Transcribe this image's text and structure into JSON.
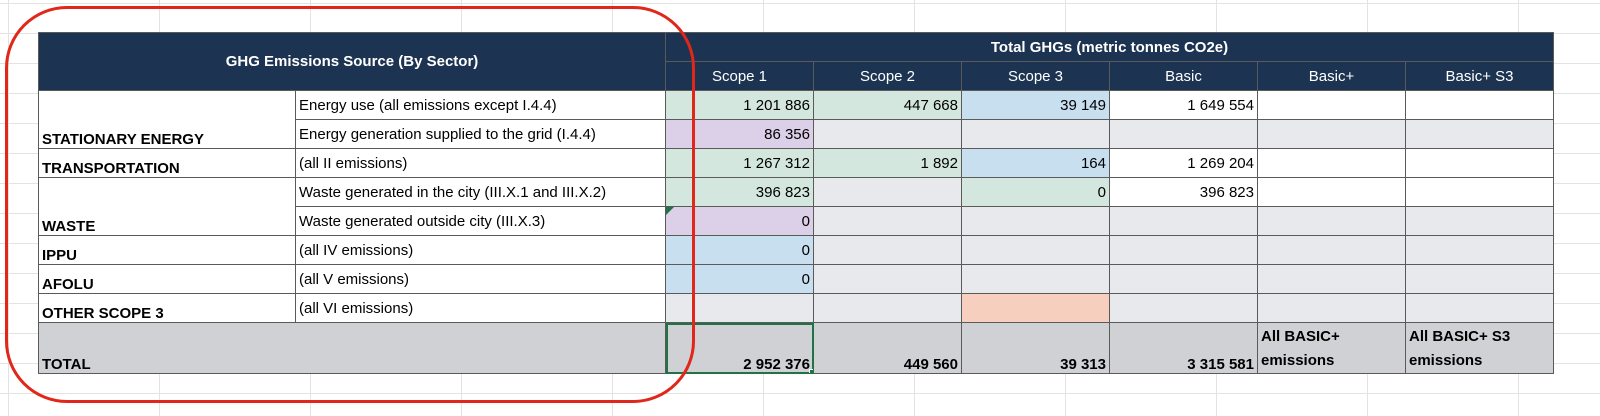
{
  "header": {
    "source_title": "GHG Emissions Source (By Sector)",
    "total_title": "Total GHGs (metric tonnes CO2e)",
    "columns": [
      "Scope 1",
      "Scope 2",
      "Scope 3",
      "Basic",
      "Basic+",
      "Basic+ S3"
    ]
  },
  "rows": [
    {
      "sector": "",
      "desc": "Energy use (all emissions except I.4.4)",
      "cells": [
        "1 201 886",
        "447 668",
        "39 149",
        "1 649 554",
        "",
        ""
      ]
    },
    {
      "sector": "STATIONARY ENERGY",
      "desc": "Energy generation supplied to the grid (I.4.4)",
      "cells": [
        "86 356",
        "",
        "",
        "",
        "",
        ""
      ]
    },
    {
      "sector": "TRANSPORTATION",
      "desc": "(all II emissions)",
      "cells": [
        "1 267 312",
        "1 892",
        "164",
        "1 269 204",
        "",
        ""
      ]
    },
    {
      "sector": "",
      "desc": "Waste generated in the city (III.X.1 and III.X.2)",
      "cells": [
        "396 823",
        "",
        "0",
        "396 823",
        "",
        ""
      ]
    },
    {
      "sector": "WASTE",
      "desc": "Waste generated outside city (III.X.3)",
      "cells": [
        "0",
        "",
        "",
        "",
        "",
        ""
      ]
    },
    {
      "sector": "IPPU",
      "desc": "(all IV emissions)",
      "cells": [
        "0",
        "",
        "",
        "",
        "",
        ""
      ]
    },
    {
      "sector": "AFOLU",
      "desc": "(all V emissions)",
      "cells": [
        "0",
        "",
        "",
        "",
        "",
        ""
      ]
    },
    {
      "sector": "OTHER SCOPE 3",
      "desc": "(all VI emissions)",
      "cells": [
        "",
        "",
        "",
        "",
        "",
        ""
      ]
    }
  ],
  "total": {
    "label": "TOTAL",
    "cells": [
      "2 952 376",
      "449 560",
      "39 313",
      "3 315 581",
      "All BASIC+ emissions",
      "All BASIC+ S3 emissions"
    ]
  },
  "colors": {
    "header_bg": "#1c3452",
    "green": "#d3e7de",
    "purple": "#dcd0e8",
    "blue": "#c8dff0",
    "orange": "#f6cfbf",
    "gray": "#e8e9ec",
    "total_bg": "#cfd1d5",
    "highlight": "#e0271a"
  }
}
